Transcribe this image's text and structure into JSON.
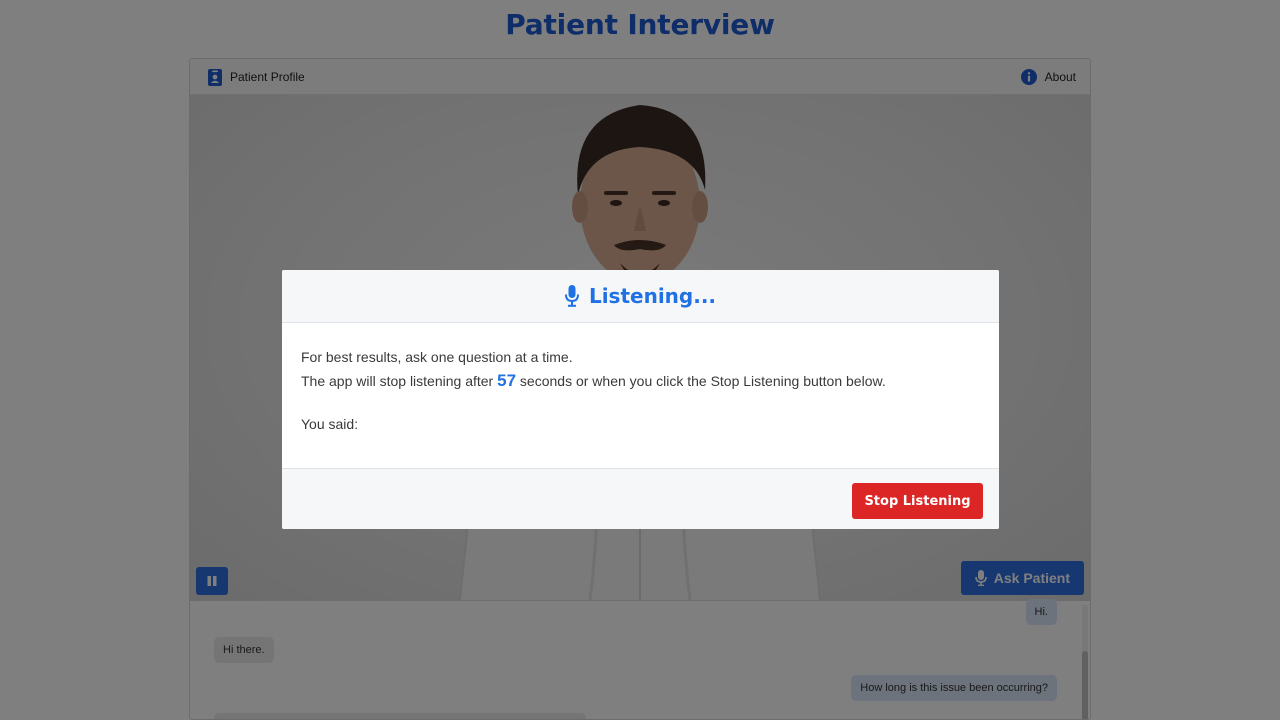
{
  "page": {
    "title": "Patient Interview"
  },
  "toolbar": {
    "profile_label": "Patient Profile",
    "about_label": "About"
  },
  "controls": {
    "ask_label": "Ask Patient"
  },
  "chat": {
    "messages": [
      {
        "role": "user",
        "text": "Hi."
      },
      {
        "role": "patient",
        "text": "Hi there."
      },
      {
        "role": "user",
        "text": "How long is this issue been occurring?"
      }
    ]
  },
  "modal": {
    "title": "Listening...",
    "line1": "For best results, ask one question at a time.",
    "line2_prefix": "The app will stop listening after",
    "seconds": "57",
    "line2_suffix": "seconds or when you click the Stop Listening button below.",
    "you_said_label": "You said:",
    "stop_label": "Stop Listening"
  },
  "colors": {
    "accent": "#1f71e4",
    "danger": "#dc2626",
    "title": "#1f5bd1"
  }
}
